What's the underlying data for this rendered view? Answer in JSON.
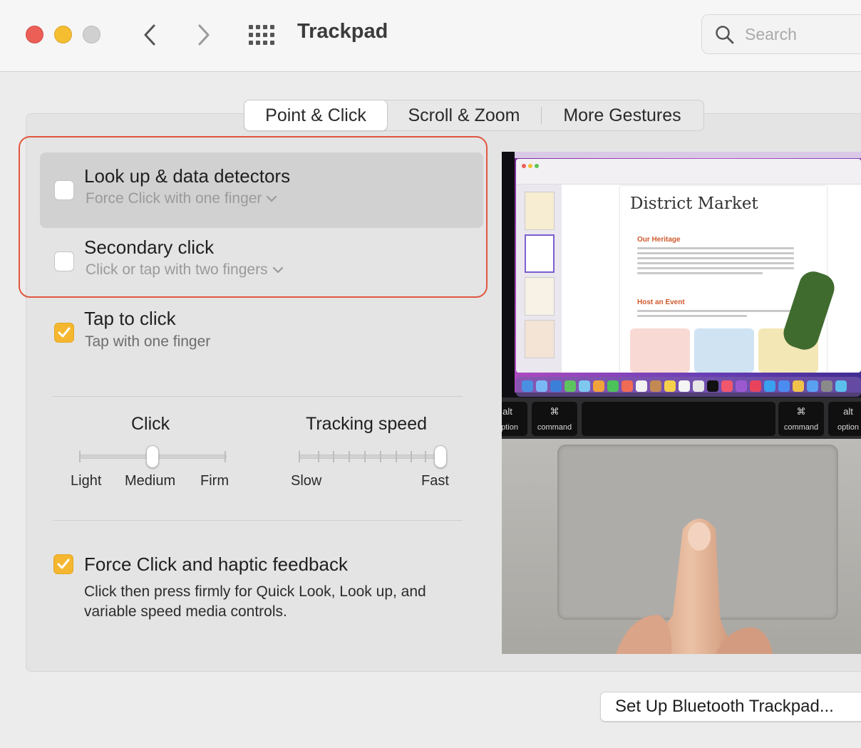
{
  "window": {
    "title": "Trackpad"
  },
  "search": {
    "placeholder": "Search",
    "value": ""
  },
  "tabs": [
    {
      "label": "Point & Click",
      "selected": true
    },
    {
      "label": "Scroll & Zoom",
      "selected": false
    },
    {
      "label": "More Gestures",
      "selected": false
    }
  ],
  "options": [
    {
      "title": "Look up & data detectors",
      "subtitle": "Force Click with one finger",
      "checked": false,
      "has_menu": true
    },
    {
      "title": "Secondary click",
      "subtitle": "Click or tap with two fingers",
      "checked": false,
      "has_menu": true
    },
    {
      "title": "Tap to click",
      "subtitle": "Tap with one finger",
      "checked": true,
      "has_menu": false
    }
  ],
  "click_slider": {
    "title": "Click",
    "labels": [
      "Light",
      "Medium",
      "Firm"
    ],
    "value": "Medium"
  },
  "tracking_slider": {
    "title": "Tracking speed",
    "min_label": "Slow",
    "max_label": "Fast",
    "value_fraction": 1.0
  },
  "force_click": {
    "title": "Force Click and haptic feedback",
    "description": "Click then press firmly for Quick Look, Look up, and variable speed media controls.",
    "checked": true
  },
  "preview": {
    "doc_title": "District Market",
    "sections": [
      "Our Heritage",
      "Host an Event"
    ],
    "keys": [
      {
        "symbol": "alt",
        "label": "option"
      },
      {
        "symbol": "⌘",
        "label": "command"
      },
      {
        "symbol": "⌘",
        "label": "command"
      },
      {
        "symbol": "alt",
        "label": "option"
      }
    ]
  },
  "bottom_button": {
    "label": "Set Up Bluetooth Trackpad..."
  },
  "colors": {
    "accent": "#f5b72f",
    "highlight_outline": "#e1573f",
    "close": "#ec5f57",
    "minimize": "#f5be31",
    "zoom_disabled": "#d0d0d0"
  }
}
